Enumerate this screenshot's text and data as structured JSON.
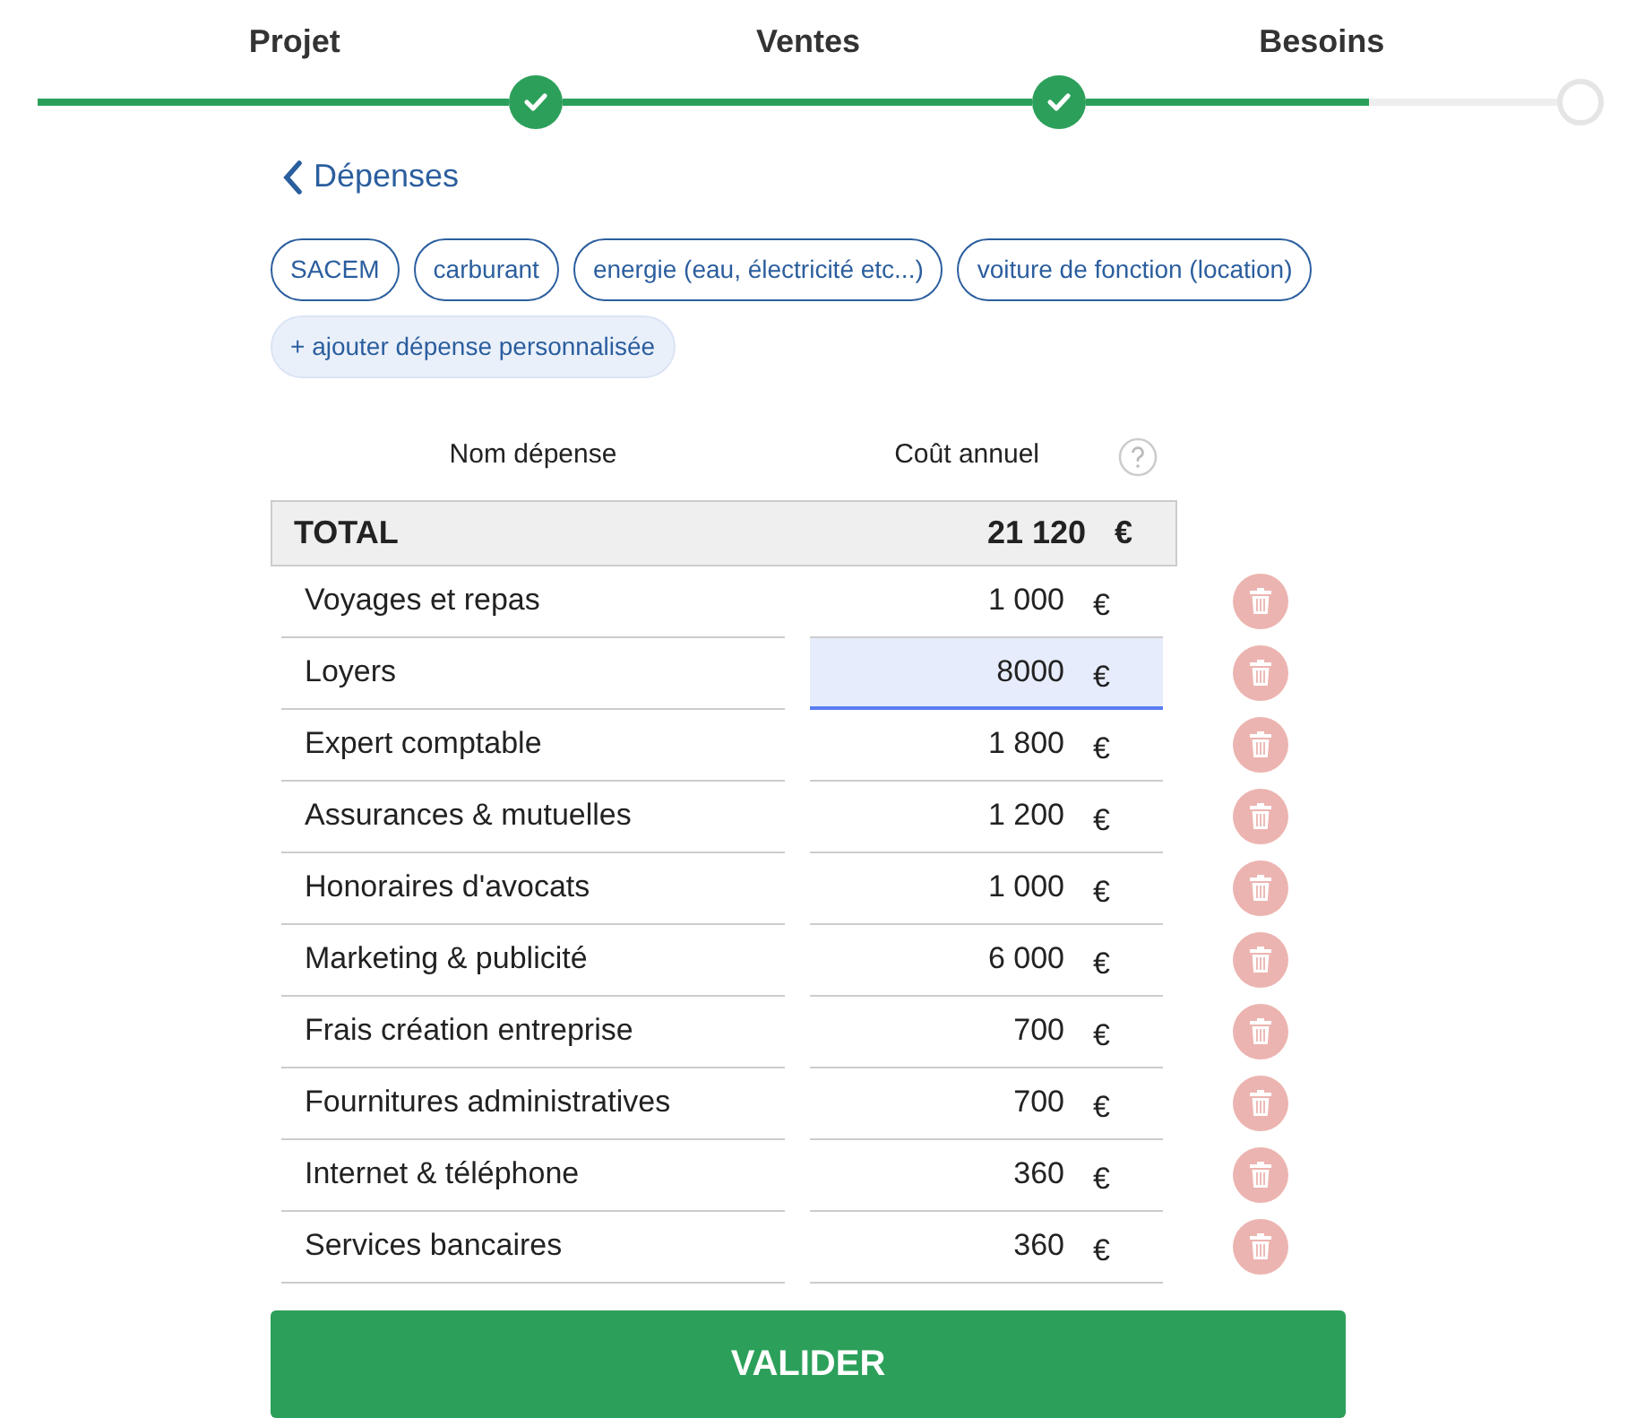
{
  "stepper": {
    "level": 0.6,
    "steps": [
      {
        "label": "Projet",
        "done": true
      },
      {
        "label": "Ventes",
        "done": true
      },
      {
        "label": "Besoins",
        "done": false
      }
    ]
  },
  "back_link": {
    "label": "Dépenses"
  },
  "suggestions": [
    {
      "label": "SACEM",
      "kind": "chip"
    },
    {
      "label": "carburant",
      "kind": "chip"
    },
    {
      "label": "energie (eau, électricité etc...)",
      "kind": "chip"
    },
    {
      "label": "voiture de fonction (location)",
      "kind": "chip"
    },
    {
      "label": "+ ajouter dépense personnalisée",
      "kind": "add"
    }
  ],
  "table": {
    "columns": [
      "Nom dépense",
      "Coût annuel"
    ],
    "total": {
      "label": "TOTAL",
      "amount": "21 120",
      "currency": "€"
    },
    "rows": [
      {
        "name": "Voyages et repas",
        "amount": "1 000",
        "currency": "€",
        "focused": false
      },
      {
        "name": "Loyers",
        "amount": "8000",
        "currency": "€",
        "focused": true
      },
      {
        "name": "Expert comptable",
        "amount": "1 800",
        "currency": "€",
        "focused": false
      },
      {
        "name": "Assurances & mutuelles",
        "amount": "1 200",
        "currency": "€",
        "focused": false
      },
      {
        "name": "Honoraires d'avocats",
        "amount": "1 000",
        "currency": "€",
        "focused": false
      },
      {
        "name": "Marketing & publicité",
        "amount": "6 000",
        "currency": "€",
        "focused": false
      },
      {
        "name": "Frais création entreprise",
        "amount": "700",
        "currency": "€",
        "focused": false
      },
      {
        "name": "Fournitures administratives",
        "amount": "700",
        "currency": "€",
        "focused": false
      },
      {
        "name": "Internet & téléphone",
        "amount": "360",
        "currency": "€",
        "focused": false
      },
      {
        "name": "Services bancaires",
        "amount": "360",
        "currency": "€",
        "focused": false
      }
    ]
  },
  "submit": {
    "label": "VALIDER"
  }
}
